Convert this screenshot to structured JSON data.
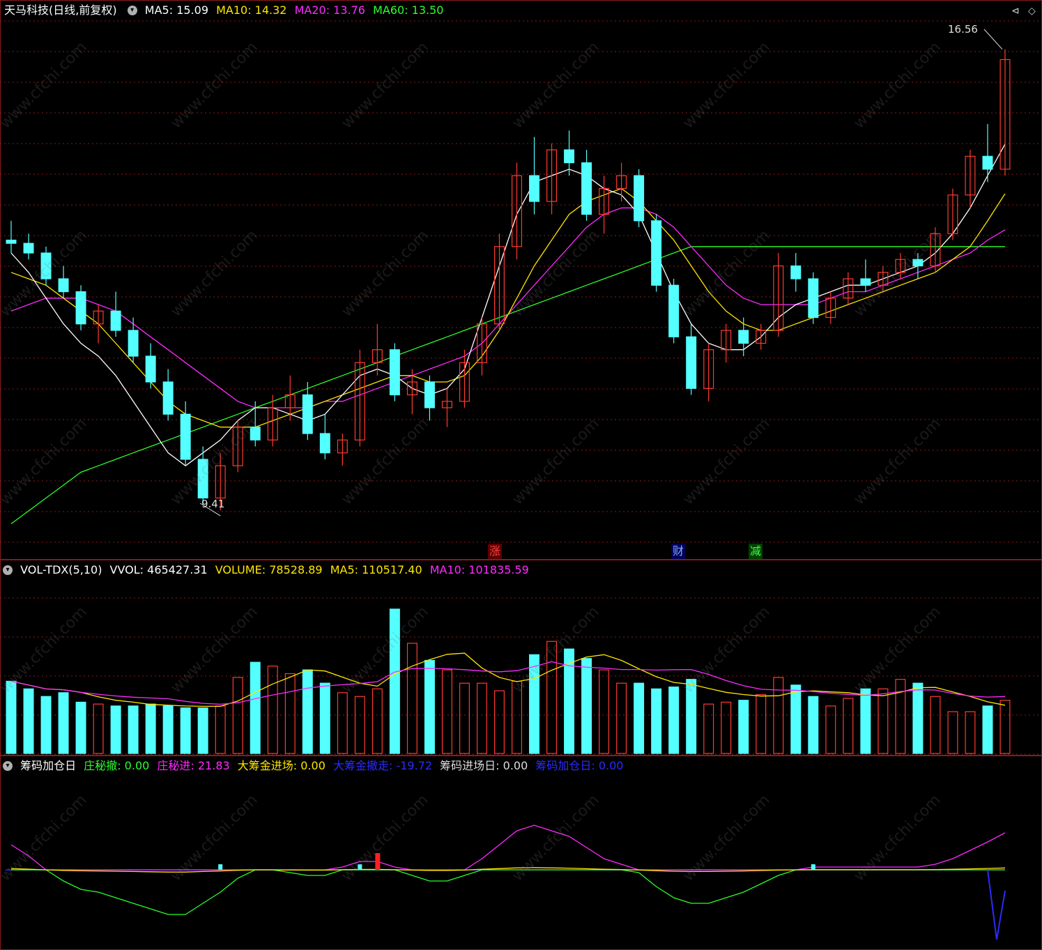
{
  "header": {
    "stock_name": "天马科技",
    "period": "(日线,前复权)",
    "ma5": "MA5: 15.09",
    "ma10": "MA10: 14.32",
    "ma20": "MA20: 13.76",
    "ma60": "MA60: 13.50"
  },
  "price_labels": {
    "high": "16.56",
    "low": "9.41"
  },
  "event_marks": [
    "涨",
    "财",
    "减"
  ],
  "volume_header": {
    "name": "VOL-TDX(5,10)",
    "vvol": "VVOL: 465427.31",
    "volume": "VOLUME: 78528.89",
    "ma5": "MA5: 110517.40",
    "ma10": "MA10: 101835.59"
  },
  "indicator_header": {
    "name": "筹码加仓日",
    "l1": "庄秘撤: 0.00",
    "l2": "庄秘进: 21.83",
    "l3": "大筹金进场: 0.00",
    "l4": "大筹金撤走: -19.72",
    "l5": "筹码进场日: 0.00",
    "l6": "筹码加仓日: 0.00"
  },
  "watermark": "www.cfchi.com",
  "colors": {
    "up": "#ff3b30",
    "down": "#54ffff",
    "ma5": "#ffffff",
    "ma10": "#ffe600",
    "ma20": "#ff2bff",
    "ma60": "#2bff2b",
    "blue": "#2b2bff",
    "grid": "#8a1a1a"
  },
  "chart_data": {
    "type": "candlestick",
    "price_range": [
      9.0,
      17.0
    ],
    "high": 16.56,
    "low": 9.41,
    "candles": [
      [
        13.6,
        13.9,
        13.4,
        13.55
      ],
      [
        13.55,
        13.7,
        13.3,
        13.4
      ],
      [
        13.4,
        13.5,
        12.9,
        13.0
      ],
      [
        13.0,
        13.2,
        12.7,
        12.8
      ],
      [
        12.8,
        12.9,
        12.2,
        12.3
      ],
      [
        12.3,
        12.6,
        12.0,
        12.5
      ],
      [
        12.5,
        12.8,
        12.1,
        12.2
      ],
      [
        12.2,
        12.4,
        11.7,
        11.8
      ],
      [
        11.8,
        12.0,
        11.3,
        11.4
      ],
      [
        11.4,
        11.6,
        10.8,
        10.9
      ],
      [
        10.9,
        11.1,
        10.1,
        10.2
      ],
      [
        10.2,
        10.4,
        9.5,
        9.6
      ],
      [
        9.6,
        10.3,
        9.41,
        10.1
      ],
      [
        10.1,
        10.8,
        10.0,
        10.7
      ],
      [
        10.7,
        11.1,
        10.4,
        10.5
      ],
      [
        10.5,
        11.2,
        10.4,
        11.0
      ],
      [
        11.0,
        11.5,
        10.8,
        11.2
      ],
      [
        11.2,
        11.4,
        10.5,
        10.6
      ],
      [
        10.6,
        10.9,
        10.2,
        10.3
      ],
      [
        10.3,
        10.6,
        10.1,
        10.5
      ],
      [
        10.5,
        11.9,
        10.4,
        11.7
      ],
      [
        11.7,
        12.3,
        11.5,
        11.9
      ],
      [
        11.9,
        12.0,
        11.1,
        11.2
      ],
      [
        11.2,
        11.6,
        10.9,
        11.4
      ],
      [
        11.4,
        11.5,
        10.8,
        11.0
      ],
      [
        11.0,
        11.3,
        10.7,
        11.1
      ],
      [
        11.1,
        11.9,
        11.0,
        11.7
      ],
      [
        11.7,
        12.4,
        11.5,
        12.3
      ],
      [
        12.3,
        13.7,
        12.2,
        13.5
      ],
      [
        13.5,
        14.8,
        13.3,
        14.6
      ],
      [
        14.6,
        15.2,
        14.0,
        14.2
      ],
      [
        14.2,
        15.1,
        14.0,
        15.0
      ],
      [
        15.0,
        15.3,
        14.6,
        14.8
      ],
      [
        14.8,
        15.0,
        13.9,
        14.0
      ],
      [
        14.0,
        14.6,
        13.7,
        14.4
      ],
      [
        14.4,
        14.8,
        14.2,
        14.6
      ],
      [
        14.6,
        14.7,
        13.8,
        13.9
      ],
      [
        13.9,
        14.0,
        12.8,
        12.9
      ],
      [
        12.9,
        13.0,
        12.0,
        12.1
      ],
      [
        12.1,
        12.3,
        11.2,
        11.3
      ],
      [
        11.3,
        12.0,
        11.1,
        11.9
      ],
      [
        11.9,
        12.3,
        11.7,
        12.2
      ],
      [
        12.2,
        12.4,
        11.8,
        12.0
      ],
      [
        12.0,
        12.3,
        11.9,
        12.2
      ],
      [
        12.2,
        13.4,
        12.1,
        13.2
      ],
      [
        13.2,
        13.4,
        12.8,
        13.0
      ],
      [
        13.0,
        13.1,
        12.3,
        12.4
      ],
      [
        12.4,
        12.8,
        12.3,
        12.7
      ],
      [
        12.7,
        13.1,
        12.6,
        13.0
      ],
      [
        13.0,
        13.3,
        12.8,
        12.9
      ],
      [
        12.9,
        13.2,
        12.8,
        13.1
      ],
      [
        13.1,
        13.4,
        13.0,
        13.3
      ],
      [
        13.3,
        13.4,
        13.0,
        13.2
      ],
      [
        13.2,
        13.8,
        13.1,
        13.7
      ],
      [
        13.7,
        14.4,
        13.6,
        14.3
      ],
      [
        14.3,
        15.0,
        14.1,
        14.9
      ],
      [
        14.9,
        15.4,
        14.5,
        14.7
      ],
      [
        14.7,
        16.56,
        14.6,
        16.4
      ]
    ],
    "volume": [
      38,
      34,
      30,
      32,
      27,
      26,
      25,
      25,
      26,
      25,
      24,
      24,
      25,
      40,
      48,
      46,
      42,
      44,
      37,
      32,
      30,
      34,
      76,
      58,
      49,
      44,
      37,
      37,
      33,
      38,
      52,
      59,
      55,
      50,
      44,
      37,
      37,
      34,
      35,
      39,
      26,
      27,
      28,
      31,
      40,
      36,
      30,
      25,
      29,
      34,
      34,
      39,
      37,
      30,
      22,
      22,
      25,
      28
    ],
    "ma5": [
      13.4,
      13.1,
      12.7,
      12.3,
      12.0,
      11.8,
      11.5,
      11.1,
      10.7,
      10.3,
      10.1,
      10.3,
      10.5,
      10.8,
      11.0,
      11.0,
      10.9,
      10.8,
      10.9,
      11.2,
      11.5,
      11.6,
      11.5,
      11.3,
      11.2,
      11.3,
      11.6,
      12.4,
      13.2,
      14.0,
      14.5,
      14.6,
      14.7,
      14.6,
      14.4,
      14.3,
      14.0,
      13.4,
      12.8,
      12.3,
      12.0,
      11.9,
      11.9,
      12.1,
      12.4,
      12.6,
      12.7,
      12.8,
      12.9,
      12.9,
      13.0,
      13.1,
      13.2,
      13.4,
      13.7,
      14.1,
      14.6,
      15.09
    ],
    "ma10": [
      13.1,
      13.0,
      12.9,
      12.7,
      12.5,
      12.3,
      12.0,
      11.7,
      11.4,
      11.1,
      10.9,
      10.8,
      10.7,
      10.7,
      10.7,
      10.8,
      10.9,
      11.0,
      11.1,
      11.2,
      11.3,
      11.4,
      11.5,
      11.5,
      11.4,
      11.4,
      11.5,
      11.8,
      12.2,
      12.7,
      13.2,
      13.6,
      14.0,
      14.2,
      14.3,
      14.4,
      14.2,
      13.9,
      13.6,
      13.2,
      12.8,
      12.5,
      12.3,
      12.2,
      12.2,
      12.3,
      12.4,
      12.5,
      12.6,
      12.7,
      12.8,
      12.9,
      13.0,
      13.1,
      13.3,
      13.5,
      13.9,
      14.32
    ],
    "ma20": [
      12.5,
      12.6,
      12.7,
      12.7,
      12.7,
      12.6,
      12.5,
      12.3,
      12.1,
      11.9,
      11.7,
      11.5,
      11.3,
      11.1,
      11.0,
      11.0,
      11.0,
      11.0,
      11.1,
      11.1,
      11.2,
      11.3,
      11.4,
      11.5,
      11.6,
      11.7,
      11.8,
      12.0,
      12.3,
      12.6,
      12.9,
      13.2,
      13.5,
      13.8,
      14.0,
      14.1,
      14.1,
      14.0,
      13.8,
      13.5,
      13.2,
      12.9,
      12.7,
      12.6,
      12.6,
      12.6,
      12.6,
      12.7,
      12.8,
      12.8,
      12.9,
      13.0,
      13.1,
      13.2,
      13.3,
      13.4,
      13.6,
      13.76
    ],
    "ma60": [
      9.2,
      9.4,
      9.6,
      9.8,
      10.0,
      10.1,
      10.2,
      10.3,
      10.4,
      10.5,
      10.6,
      10.7,
      10.8,
      10.9,
      11.0,
      11.1,
      11.2,
      11.3,
      11.4,
      11.5,
      11.6,
      11.7,
      11.8,
      11.9,
      12.0,
      12.1,
      12.2,
      12.3,
      12.4,
      12.5,
      12.6,
      12.7,
      12.8,
      12.9,
      13.0,
      13.1,
      13.2,
      13.3,
      13.4,
      13.5,
      13.5,
      13.5,
      13.5,
      13.5,
      13.5,
      13.5,
      13.5,
      13.5,
      13.5,
      13.5,
      13.5,
      13.5,
      13.5,
      13.5,
      13.5,
      13.5,
      13.5,
      13.5
    ]
  }
}
